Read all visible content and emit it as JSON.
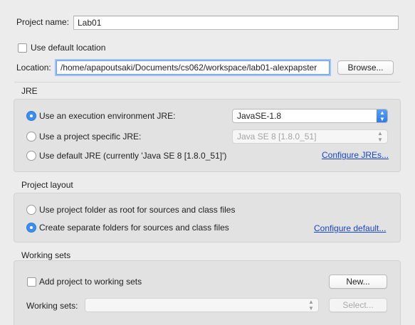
{
  "project": {
    "name_label": "Project name:",
    "name_value": "Lab01",
    "use_default_location_label": "Use default location",
    "location_label": "Location:",
    "location_value": "/home/apapoutsaki/Documents/cs062/workspace/lab01-alexpapster",
    "browse_label": "Browse..."
  },
  "jre": {
    "title": "JRE",
    "option_env_label": "Use an execution environment JRE:",
    "env_value": "JavaSE-1.8",
    "option_specific_label": "Use a project specific JRE:",
    "specific_value": "Java SE 8 [1.8.0_51]",
    "option_default_label": "Use default JRE (currently 'Java SE 8 [1.8.0_51]')",
    "configure_link": "Configure JREs..."
  },
  "layout": {
    "title": "Project layout",
    "option_root_label": "Use project folder as root for sources and class files",
    "option_separate_label": "Create separate folders for sources and class files",
    "configure_link": "Configure default..."
  },
  "working_sets": {
    "title": "Working sets",
    "add_label": "Add project to working sets",
    "new_label": "New...",
    "sets_label": "Working sets:",
    "sets_value": "",
    "select_label": "Select..."
  }
}
